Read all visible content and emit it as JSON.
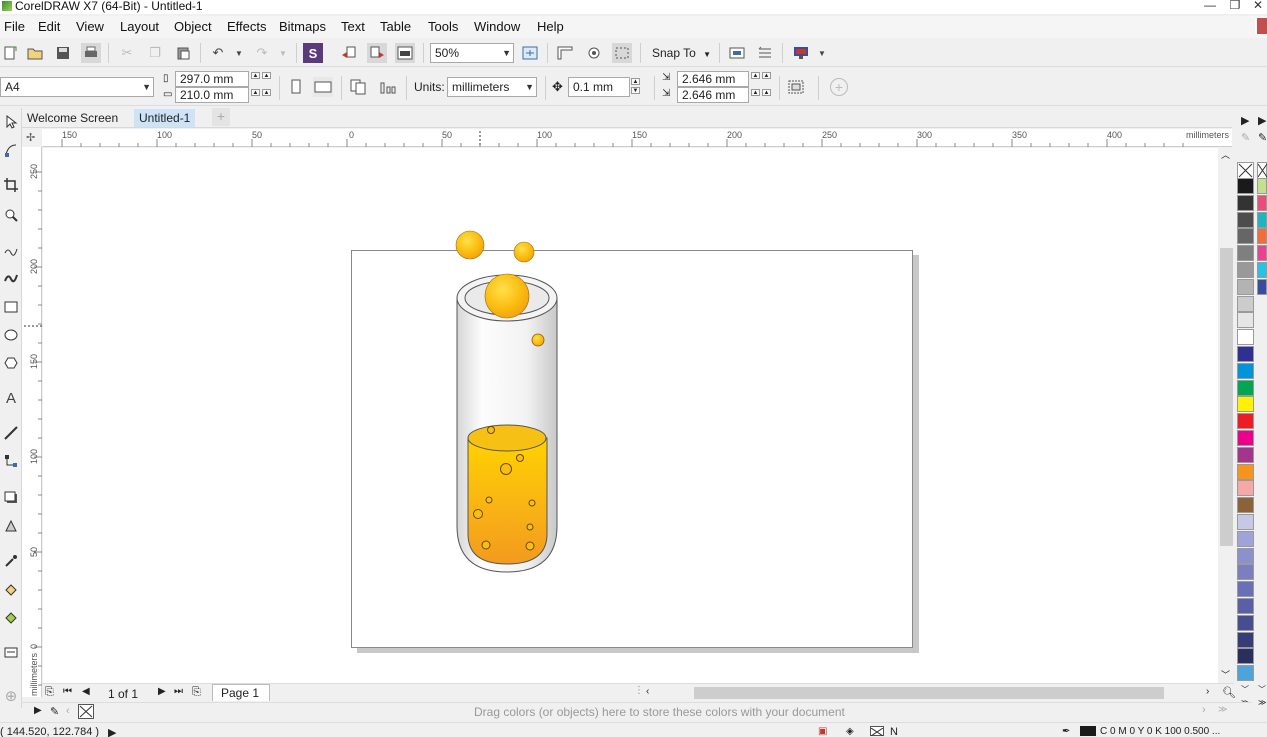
{
  "window": {
    "title": "CorelDRAW X7 (64-Bit) - Untitled-1",
    "minimize_glyph": "—",
    "restore_glyph": "❐",
    "close_glyph": "✕"
  },
  "menu": {
    "items": [
      {
        "label": "File"
      },
      {
        "label": "Edit"
      },
      {
        "label": "View"
      },
      {
        "label": "Layout"
      },
      {
        "label": "Object"
      },
      {
        "label": "Effects"
      },
      {
        "label": "Bitmaps"
      },
      {
        "label": "Text"
      },
      {
        "label": "Table"
      },
      {
        "label": "Tools"
      },
      {
        "label": "Window"
      },
      {
        "label": "Help"
      }
    ]
  },
  "standard_toolbar": {
    "zoom_value": "50%",
    "snap_to_label": "Snap To"
  },
  "property_bar": {
    "page_size": "A4",
    "width_value": "297.0 mm",
    "height_value": "210.0 mm",
    "units_label": "Units:",
    "units_value": "millimeters",
    "nudge_value": "0.1 mm",
    "dup_x_value": "2.646 mm",
    "dup_y_value": "2.646 mm"
  },
  "doc_tabs": [
    {
      "label": "Welcome Screen",
      "active": false
    },
    {
      "label": "Untitled-1",
      "active": true
    }
  ],
  "rulers": {
    "h_labels": [
      "150",
      "100",
      "50",
      "0",
      "50",
      "100",
      "150",
      "200",
      "250",
      "300",
      "350",
      "400"
    ],
    "h_unit": "millimeters",
    "v_labels": [
      "250",
      "200",
      "150",
      "100",
      "50",
      "0"
    ],
    "v_unit": "millimeters"
  },
  "page_nav": {
    "counter": "1 of 1",
    "page_tab": "Page 1"
  },
  "document_palette": {
    "hint": "Drag colors (or objects) here to store these colors with your document"
  },
  "status_bar": {
    "cursor_pos": "( 144.520, 122.784 )",
    "fill_info": "C 0 M 0 Y 0 K 100  0.500 ...",
    "outline_label": "N"
  },
  "palette_colors": [
    "#1a1a1a",
    "#333333",
    "#4d4d4d",
    "#666666",
    "#7f7f7f",
    "#999999",
    "#b3b3b3",
    "#cccccc",
    "#e6e6e6",
    "#ffffff",
    "#2e3192",
    "#0095da",
    "#00a651",
    "#fff200",
    "#ed1c24",
    "#ec008c",
    "#a3358c",
    "#f7941d",
    "#f5a9a6",
    "#8c6239",
    "#c7c8e5",
    "#a0a3d7",
    "#8c90cc",
    "#7b7fc2",
    "#6a70b8",
    "#5a60a7",
    "#474d91",
    "#363c77",
    "#2b2f5e",
    "#4ea3d9"
  ],
  "palette2_colors": [
    "#c3e08a",
    "#e94d7a",
    "#1fb5c0",
    "#f26c3c",
    "#e84393",
    "#29c2e6",
    "#3a4ba0"
  ]
}
